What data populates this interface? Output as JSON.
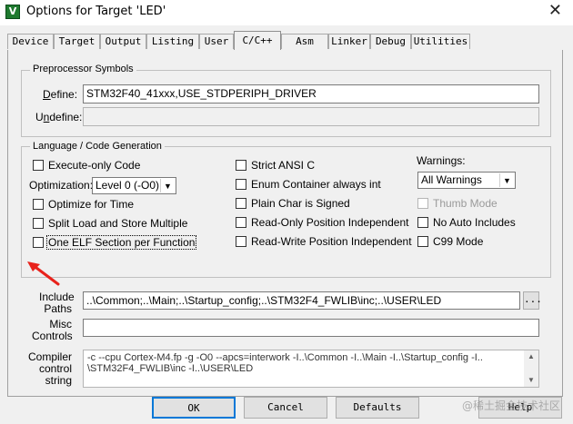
{
  "window": {
    "title": "Options for Target 'LED'",
    "icon": "keil-uvision-icon"
  },
  "tabs": [
    {
      "label": "Device"
    },
    {
      "label": "Target"
    },
    {
      "label": "Output"
    },
    {
      "label": "Listing"
    },
    {
      "label": "User"
    },
    {
      "label": "C/C++"
    },
    {
      "label": "Asm"
    },
    {
      "label": "Linker"
    },
    {
      "label": "Debug"
    },
    {
      "label": "Utilities"
    }
  ],
  "active_tab": "C/C++",
  "preprocessor": {
    "title": "Preprocessor Symbols",
    "define_label": "Define:",
    "define_value": "STM32F40_41xxx,USE_STDPERIPH_DRIVER",
    "undefine_label": "Undefine:",
    "undefine_value": ""
  },
  "language": {
    "title": "Language / Code Generation",
    "execute_only": "Execute-only Code",
    "optimization_label": "Optimization:",
    "optimization_value": "Level 0 (-O0)",
    "optimize_time": "Optimize for Time",
    "split_load": "Split Load and Store Multiple",
    "one_elf": "One ELF Section per Function",
    "strict_ansi": "Strict ANSI C",
    "enum_container": "Enum Container always int",
    "plain_char": "Plain Char is Signed",
    "ropi": "Read-Only Position Independent",
    "rwpi": "Read-Write Position Independent",
    "warnings_label": "Warnings:",
    "warnings_value": "All Warnings",
    "thumb_mode": "Thumb Mode",
    "no_auto_includes": "No Auto Includes",
    "c99_mode": "C99 Mode"
  },
  "include": {
    "label_line1": "Include",
    "label_line2": "Paths",
    "value": "..\\Common;..\\Main;..\\Startup_config;..\\STM32F4_FWLIB\\inc;..\\USER\\LED",
    "browse": "..."
  },
  "misc": {
    "label_line1": "Misc",
    "label_line2": "Controls",
    "value": ""
  },
  "compiler": {
    "label_line1": "Compiler",
    "label_line2": "control",
    "label_line3": "string",
    "line1": "-c --cpu Cortex-M4.fp -g -O0 --apcs=interwork -I..\\Common -I..\\Main -I..\\Startup_config -I..",
    "line2": "\\STM32F4_FWLIB\\inc -I..\\USER\\LED"
  },
  "buttons": {
    "ok": "OK",
    "cancel": "Cancel",
    "defaults": "Defaults",
    "help": "Help"
  },
  "watermark": "@稀土掘金技术社区",
  "colors": {
    "annotation_arrow": "#e8221b",
    "window_bg": "#f0f0f0"
  }
}
